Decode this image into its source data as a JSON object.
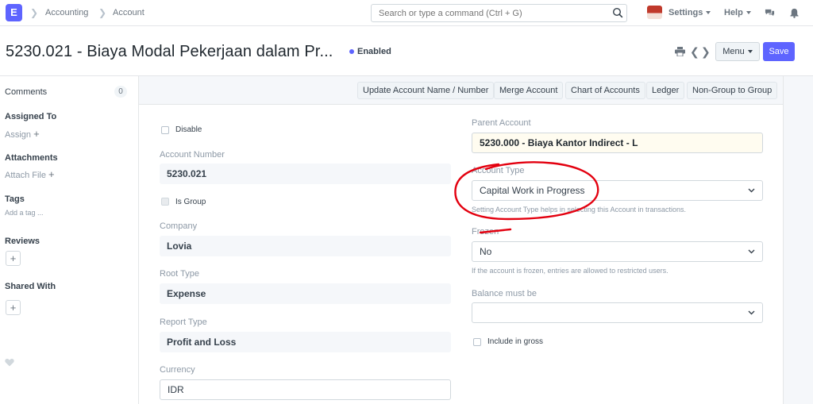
{
  "navbar": {
    "logo_letter": "E",
    "breadcrumbs": [
      "Accounting",
      "Account"
    ],
    "search_placeholder": "Search or type a command (Ctrl + G)",
    "settings_label": "Settings",
    "help_label": "Help",
    "icons": [
      "search-icon",
      "chat-icon",
      "bell-icon"
    ]
  },
  "page": {
    "title": "5230.021 - Biaya Modal Pekerjaan dalam Pr...",
    "status": "Enabled",
    "menu_label": "Menu",
    "save_label": "Save",
    "accent_color": "#5e64ff"
  },
  "sidebar": {
    "comments_label": "Comments",
    "comments_count": "0",
    "assigned_to": "Assigned To",
    "assign": "Assign",
    "attachments": "Attachments",
    "attach_file": "Attach File",
    "tags": "Tags",
    "add_tag": "Add a tag ...",
    "reviews": "Reviews",
    "shared_with": "Shared With"
  },
  "toolbar": {
    "buttons": [
      "Update Account Name / Number",
      "Merge Account",
      "Chart of Accounts",
      "Ledger",
      "Non-Group to Group"
    ]
  },
  "form": {
    "disable_label": "Disable",
    "account_number_label": "Account Number",
    "account_number": "5230.021",
    "is_group_label": "Is Group",
    "company_label": "Company",
    "company": "Lovia",
    "root_type_label": "Root Type",
    "root_type": "Expense",
    "report_type_label": "Report Type",
    "report_type": "Profit and Loss",
    "currency_label": "Currency",
    "currency": "IDR",
    "parent_account_label": "Parent Account",
    "parent_account": "5230.000 - Biaya Kantor Indirect - L",
    "account_type_label": "Account Type",
    "account_type": "Capital Work in Progress",
    "account_type_help": "Setting Account Type helps in selecting this Account in transactions.",
    "frozen_label": "Frozen",
    "frozen": "No",
    "frozen_help": "If the account is frozen, entries are allowed to restricted users.",
    "balance_label": "Balance must be",
    "balance": "",
    "include_gross_label": "Include in gross"
  },
  "annotation_color": "#e3000f"
}
